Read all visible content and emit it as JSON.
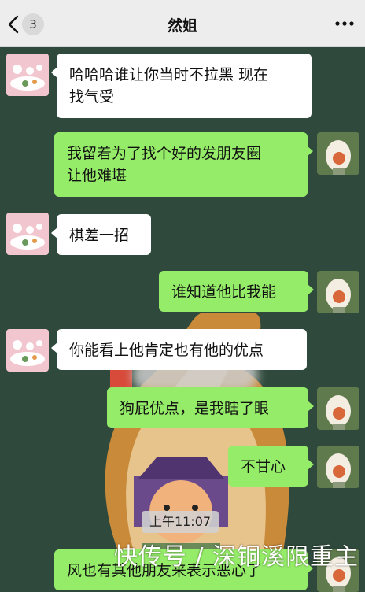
{
  "header": {
    "title": "然姐",
    "unread_count": "3"
  },
  "messages": [
    {
      "sender": "other",
      "text_lines": [
        "哈哈哈谁让你当时不拉黑 现在",
        "找气受"
      ]
    },
    {
      "sender": "me",
      "text_lines": [
        "我留着为了找个好的发朋友圈",
        "让他难堪"
      ]
    },
    {
      "sender": "other",
      "text_lines": [
        "棋差一招"
      ]
    },
    {
      "sender": "me",
      "text_lines": [
        "谁知道他比我能"
      ]
    },
    {
      "sender": "other",
      "text_lines": [
        "你能看上他肯定也有他的优点"
      ]
    },
    {
      "sender": "me",
      "text_lines": [
        "狗屁优点，是我瞎了眼"
      ]
    },
    {
      "sender": "me",
      "text_lines": [
        "不甘心"
      ]
    },
    {
      "sender": "me",
      "text_lines": [
        "风也有其他朋友来表示恶心了"
      ]
    }
  ],
  "timestamp": "上午11:07",
  "watermark": "快传号 / 深铜溪限重主",
  "colors": {
    "header_bg": "#ededed",
    "wallpaper_bg": "#2f4a3c",
    "incoming_bubble": "#ffffff",
    "outgoing_bubble": "#95ec69"
  },
  "icons": {
    "back": "chevron-left-icon",
    "more": "more-dots-icon"
  }
}
